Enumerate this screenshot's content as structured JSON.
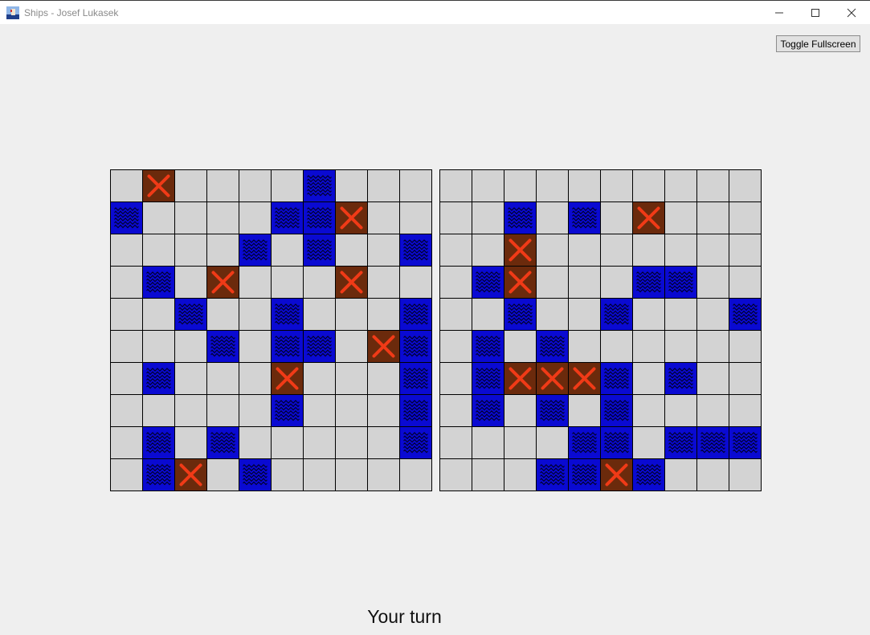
{
  "window": {
    "title": "Ships - Josef Lukasek",
    "app_icon": "ship-app-icon",
    "controls": [
      "minimize-icon",
      "maximize-icon",
      "close-icon"
    ]
  },
  "toolbar": {
    "toggle_fullscreen_label": "Toggle Fullscreen"
  },
  "legend": {
    "cell_states": {
      ".": "empty-unrevealed",
      "W": "water-miss",
      "X": "hit"
    },
    "colors": {
      "empty": "#d3d3d3",
      "water": "#0a0ad2",
      "hit": "#6b2a0c",
      "hit_mark": "#f03a17",
      "grid_line": "#000000",
      "background": "#efefef"
    }
  },
  "boards": [
    {
      "name": "left-board",
      "rows": [
        ".X....W...",
        "W....WWX..",
        "....W.W..W",
        ".W.X...X..",
        "..W..W...W",
        "...W.WW.XW",
        ".W...X...W",
        ".....W...W",
        ".W.W.....W",
        ".WX.W....."
      ]
    },
    {
      "name": "right-board",
      "rows": [
        "..........",
        "..W.W.X...",
        "..X.......",
        ".WX...WW..",
        "..W..W...W",
        ".W.W......",
        ".WXXXW.W..",
        ".W.W.W....",
        "....WW.WWW",
        "...WWXW..."
      ]
    }
  ],
  "status": {
    "text": "Your turn"
  }
}
